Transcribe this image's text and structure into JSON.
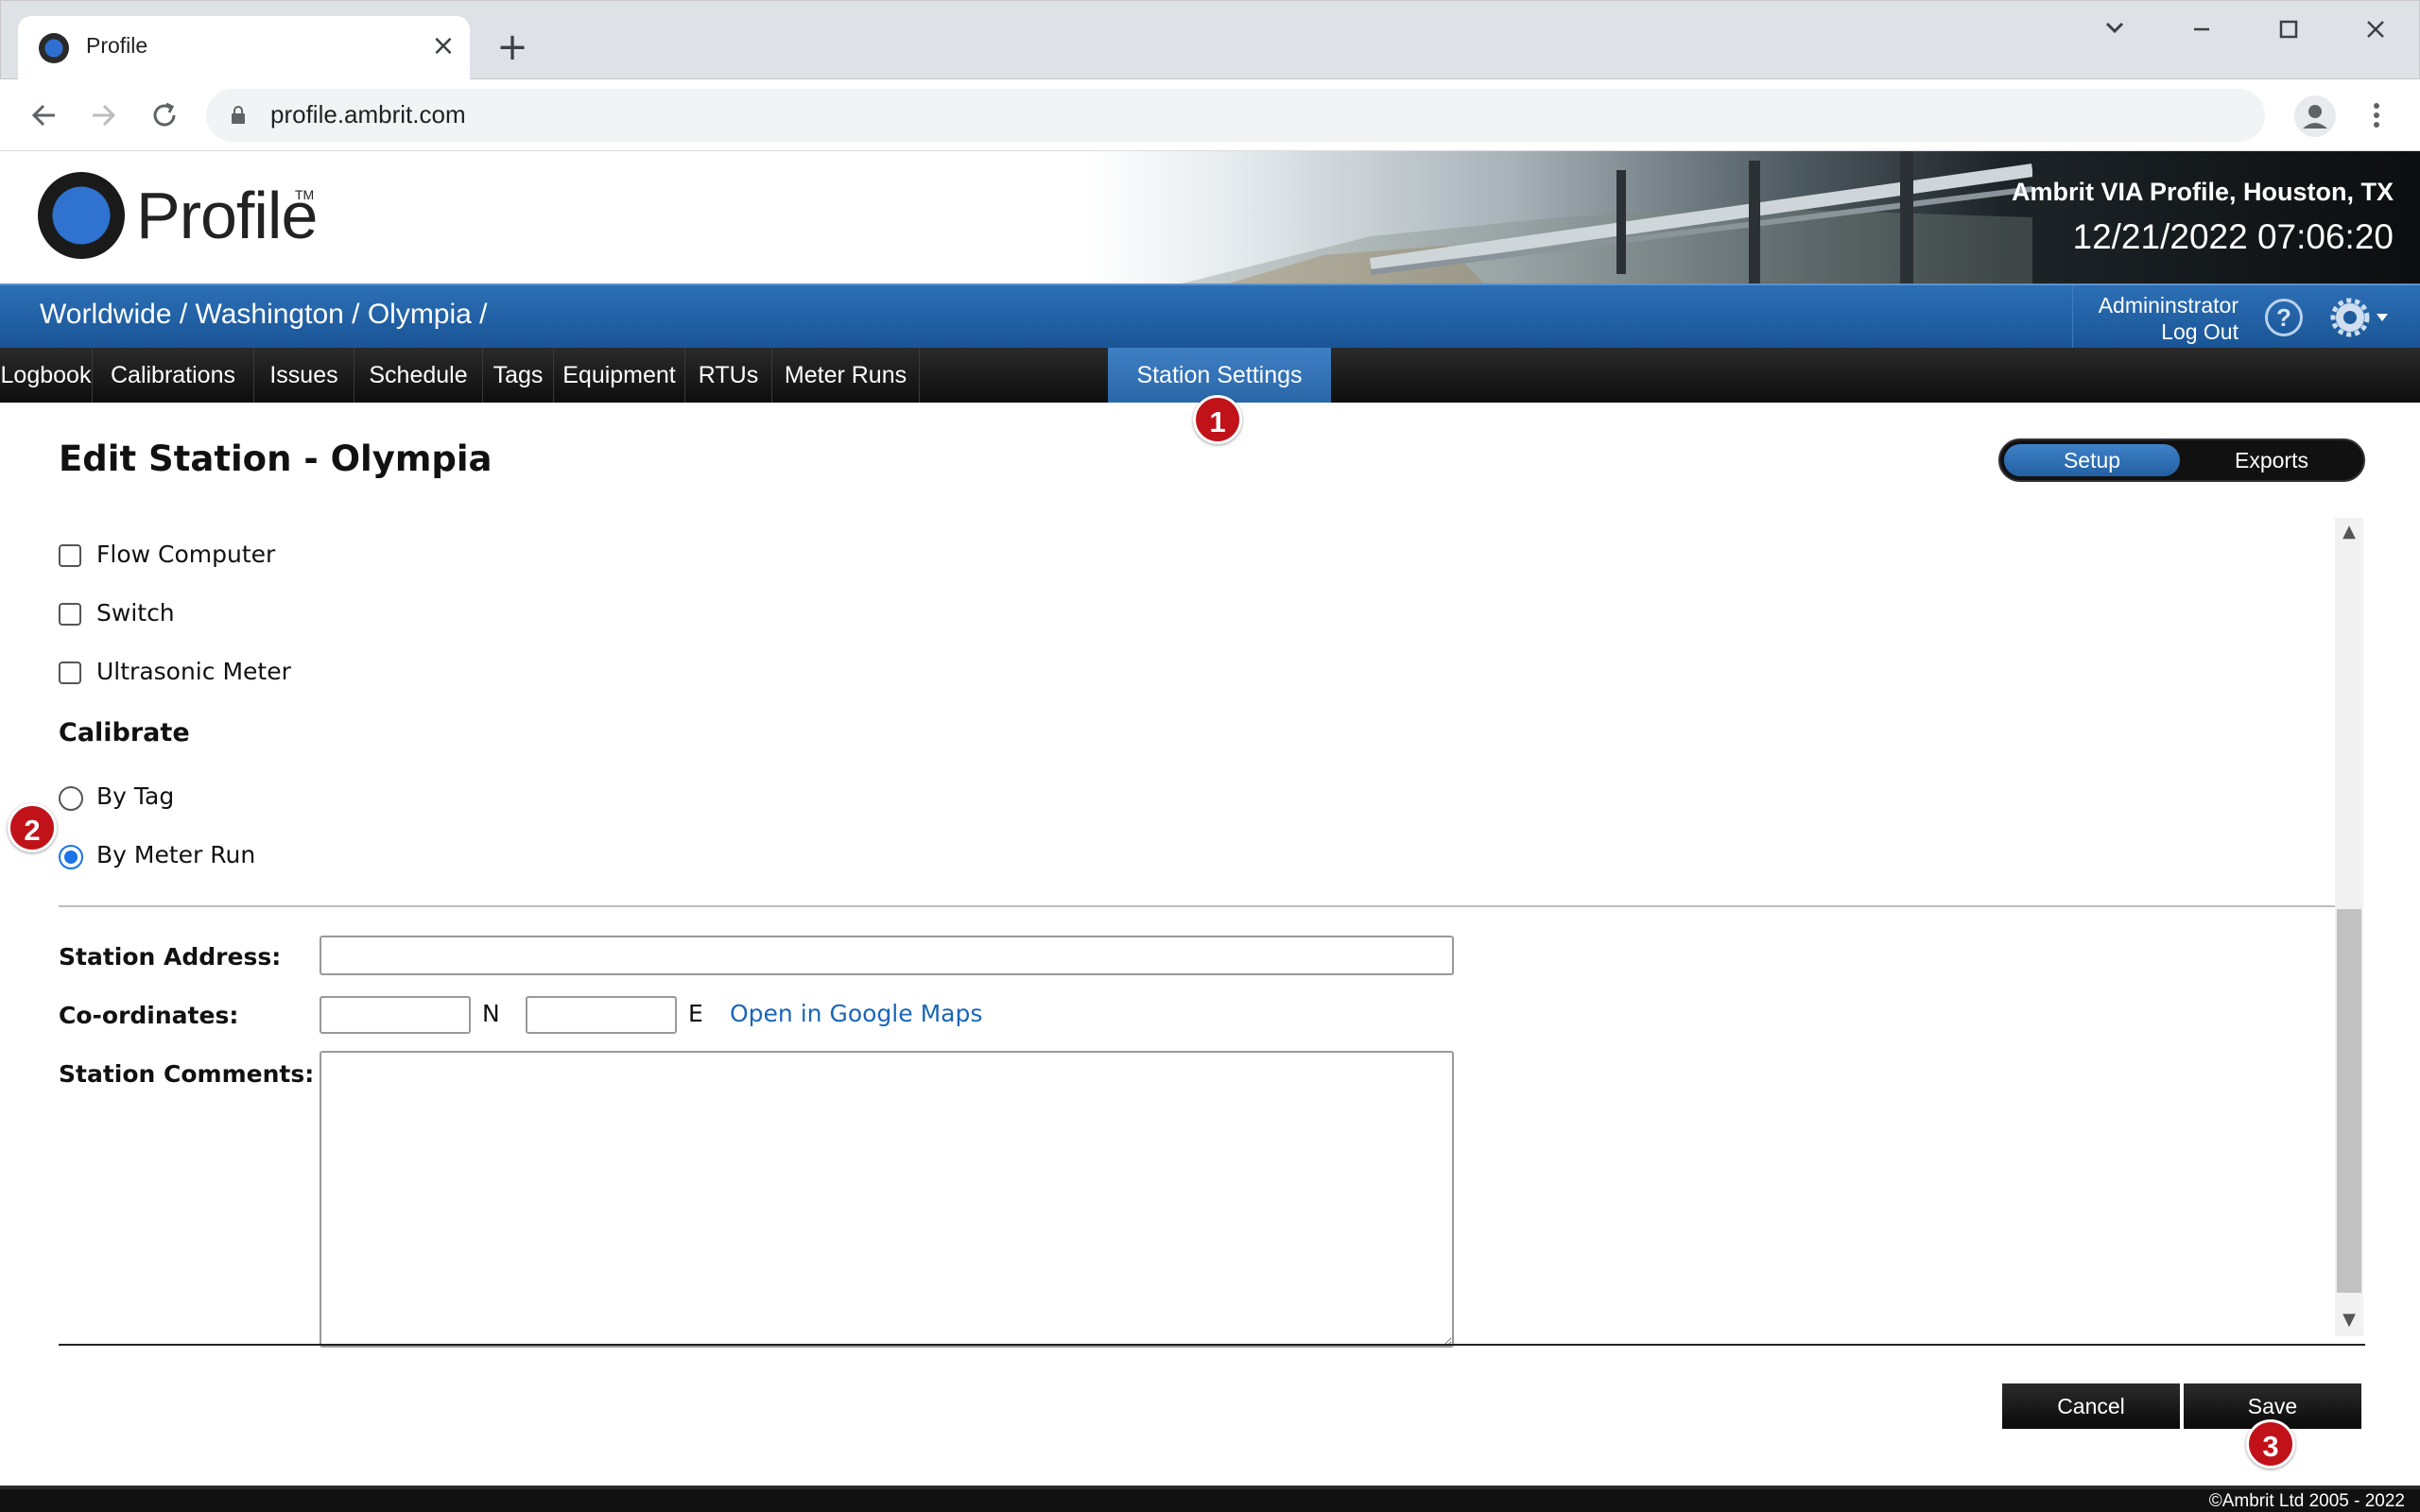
{
  "browser": {
    "tab_title": "Profile",
    "url": "profile.ambrit.com"
  },
  "header": {
    "brand": "Profile",
    "trademark": "TM",
    "site_name": "Ambrit VIA Profile, Houston, TX",
    "clock": "12/21/2022 07:06:20"
  },
  "breadcrumb": "Worldwide / Washington / Olympia /",
  "user": {
    "name": "Admininstrator",
    "logout": "Log Out",
    "help": "?"
  },
  "nav": {
    "items": [
      {
        "label": "Logbook"
      },
      {
        "label": "Calibrations"
      },
      {
        "label": "Issues"
      },
      {
        "label": "Schedule"
      },
      {
        "label": "Tags"
      },
      {
        "label": "Equipment"
      },
      {
        "label": "RTUs"
      },
      {
        "label": "Meter Runs"
      },
      {
        "label": "Station Settings",
        "active": true
      }
    ]
  },
  "markers": [
    "1",
    "2",
    "3"
  ],
  "page": {
    "title": "Edit Station - Olympia",
    "segments": {
      "setup": "Setup",
      "exports": "Exports",
      "selected": "Setup"
    }
  },
  "form": {
    "equipment_options": [
      {
        "label": "Flow Computer",
        "checked": false
      },
      {
        "label": "Switch",
        "checked": false
      },
      {
        "label": "Ultrasonic Meter",
        "checked": false
      }
    ],
    "calibrate_heading": "Calibrate",
    "calibrate_options": [
      {
        "label": "By Tag",
        "selected": false
      },
      {
        "label": "By Meter Run",
        "selected": true
      }
    ],
    "address_label": "Station Address:",
    "address_value": "",
    "coordinates_label": "Co-ordinates:",
    "coord_n_value": "",
    "coord_n_unit": "N",
    "coord_e_value": "",
    "coord_e_unit": "E",
    "maps_link": "Open in Google Maps",
    "comments_label": "Station Comments:",
    "comments_value": ""
  },
  "actions": {
    "cancel": "Cancel",
    "save": "Save"
  },
  "footer": {
    "copyright": "©Ambrit Ltd 2005 - 2022"
  },
  "colors": {
    "accent_blue": "#2a67a8",
    "marker_red": "#c1121a",
    "nav_black": "#111111",
    "link_blue": "#1a66b8"
  }
}
